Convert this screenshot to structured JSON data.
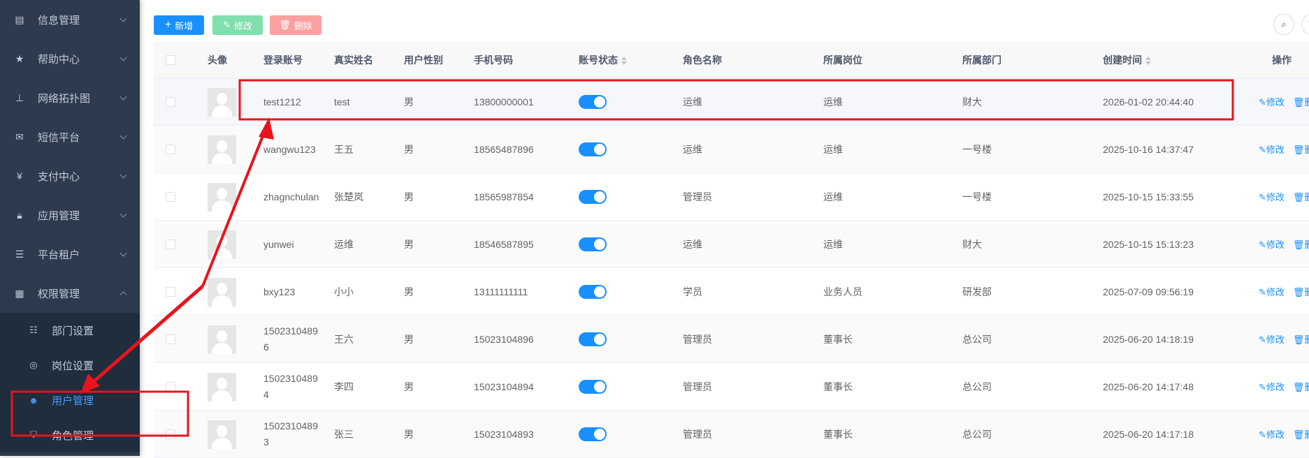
{
  "sidebar": {
    "items": [
      {
        "label": "信息管理",
        "icon": "document-icon"
      },
      {
        "label": "帮助中心",
        "icon": "star-icon"
      },
      {
        "label": "网络拓扑图",
        "icon": "sitemap-icon"
      },
      {
        "label": "短信平台",
        "icon": "envelope-icon"
      },
      {
        "label": "支付中心",
        "icon": "yen-icon"
      },
      {
        "label": "应用管理",
        "icon": "lock-icon"
      },
      {
        "label": "平台租户",
        "icon": "list-icon"
      },
      {
        "label": "权限管理",
        "icon": "table-icon"
      }
    ],
    "submenu": [
      {
        "label": "部门设置",
        "icon": "tree-icon"
      },
      {
        "label": "岗位设置",
        "icon": "post-icon"
      },
      {
        "label": "用户管理",
        "icon": "user-icon",
        "active": true
      },
      {
        "label": "角色管理",
        "icon": "shield-icon"
      }
    ]
  },
  "toolbar": {
    "add": "新增",
    "edit": "修改",
    "delete": "删除",
    "add_color": "#1890ff",
    "edit_color": "#80dfac",
    "delete_color": "#fda0a0"
  },
  "table": {
    "headers": [
      "头像",
      "登录账号",
      "真实姓名",
      "用户性别",
      "手机号码",
      "账号状态",
      "角色名称",
      "所属岗位",
      "所属部门",
      "创建时间",
      "操作"
    ],
    "action_edit": "修改",
    "action_delete": "删",
    "rows": [
      {
        "account": "test1212",
        "name": "test",
        "gender": "男",
        "phone": "13800000001",
        "enabled": true,
        "role": "运维",
        "post": "运维",
        "dept": "财大",
        "created": "2026-01-02 20:44:40"
      },
      {
        "account": "wangwu123",
        "name": "王五",
        "gender": "男",
        "phone": "18565487896",
        "enabled": true,
        "role": "运维",
        "post": "运维",
        "dept": "一号楼",
        "created": "2025-10-16 14:37:47"
      },
      {
        "account": "zhagnchulan",
        "name": "张楚岚",
        "gender": "男",
        "phone": "18565987854",
        "enabled": true,
        "role": "管理员",
        "post": "运维",
        "dept": "一号楼",
        "created": "2025-10-15 15:33:55"
      },
      {
        "account": "yunwei",
        "name": "运维",
        "gender": "男",
        "phone": "18546587895",
        "enabled": true,
        "role": "运维",
        "post": "运维",
        "dept": "财大",
        "created": "2025-10-15 15:13:23"
      },
      {
        "account": "bxy123",
        "name": "小小",
        "gender": "男",
        "phone": "13111111111",
        "enabled": true,
        "role": "学员",
        "post": "业务人员",
        "dept": "研发部",
        "created": "2025-07-09 09:56:19"
      },
      {
        "account": "15023104896",
        "name": "王六",
        "gender": "男",
        "phone": "15023104896",
        "enabled": true,
        "role": "管理员",
        "post": "董事长",
        "dept": "总公司",
        "created": "2025-06-20 14:18:19"
      },
      {
        "account": "15023104894",
        "name": "李四",
        "gender": "男",
        "phone": "15023104894",
        "enabled": true,
        "role": "管理员",
        "post": "董事长",
        "dept": "总公司",
        "created": "2025-06-20 14:17:48"
      },
      {
        "account": "15023104893",
        "name": "张三",
        "gender": "男",
        "phone": "15023104893",
        "enabled": true,
        "role": "管理员",
        "post": "董事长",
        "dept": "总公司",
        "created": "2025-06-20 14:17:18"
      }
    ]
  },
  "annotation_color": "#e8141b"
}
